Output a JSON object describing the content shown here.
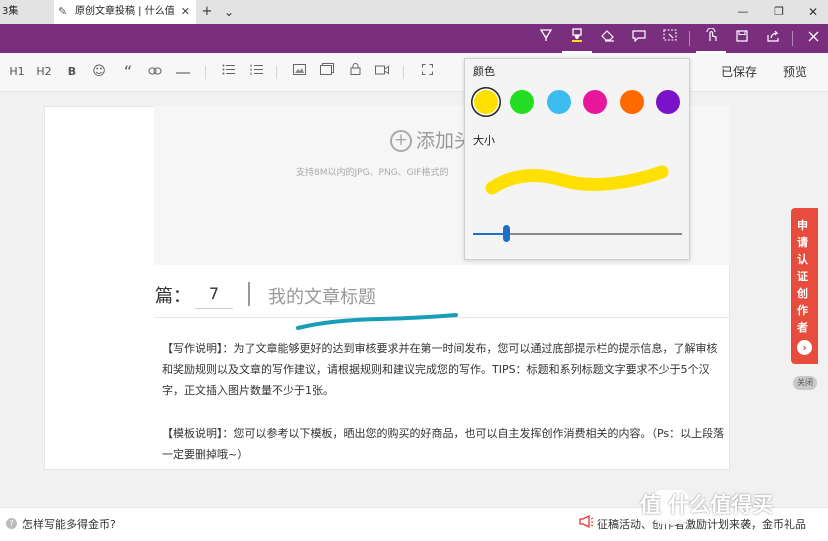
{
  "browser": {
    "prev_tab_label": "3集",
    "active_tab_title": "原创文章投稿 | 什么值得",
    "new_tab": "+",
    "tab_menu": "⌄",
    "minimize": "—",
    "restore": "❐",
    "close": "✕"
  },
  "ink_toolbar": {
    "tools": [
      "ballpoint-pen-icon",
      "highlighter-icon",
      "eraser-icon",
      "add-note-icon",
      "clip-icon",
      "touch-write-icon",
      "save-icon",
      "share-icon",
      "exit-icon"
    ],
    "selected": "highlighter-icon"
  },
  "editor_toolbar": {
    "h1": "H1",
    "h2": "H2",
    "bold": "B",
    "saved": "已保存",
    "preview": "预览"
  },
  "document": {
    "add_cover": "添加头",
    "cover_hint": "支持8M以内的JPG、PNG、GIF格式的",
    "episode_label": "篇：",
    "episode_number": "7",
    "title_placeholder": "我的文章标题",
    "writing_note": "【写作说明】：为了文章能够更好的达到审核要求并在第一时间发布，您可以通过底部提示栏的提示信息，了解审核和奖励规则以及文章的写作建议，请根据规则和建议完成您的写作。TIPS：标题和系列标题文字要求不少于5个汉字，正文插入图片数量不少于1张。",
    "template_note": "【模板说明】：您可以参考以下模板，晒出您的购买的好商品，也可以自主发挥创作消费相关的内容。（Ps：以上段落一定要删掉哦~）"
  },
  "ink_popup": {
    "color_label": "颜色",
    "size_label": "大小",
    "colors": [
      "#ffe000",
      "#22dd22",
      "#3dbcf0",
      "#e8169a",
      "#ff6a00",
      "#7a12c9"
    ],
    "selected_color": "#ffe000",
    "size_level": 0.16
  },
  "side_tab": {
    "apply_label": "申请认证创作者",
    "close_label": "关闭"
  },
  "status_bar": {
    "help_text": "怎样写能多得金币?",
    "promo_text": "征稿活动、创作者激励计划来袭，金币礼品"
  },
  "watermark": "值 什么值得买",
  "colors": {
    "ink_bar": "#7a2f7e",
    "ink_stroke": "#1a9db8",
    "highlight_preview": "#ffe000",
    "side_tab": "#e74c3c",
    "slider": "#1e6fc8"
  }
}
